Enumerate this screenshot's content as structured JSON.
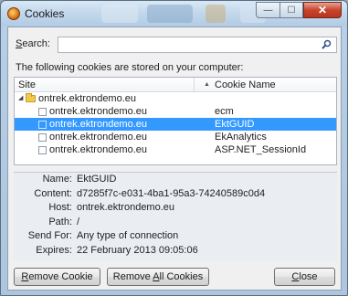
{
  "window": {
    "title": "Cookies",
    "buttons": {
      "minimize": "—",
      "maximize": "☐",
      "close": "✕"
    }
  },
  "search": {
    "label_accesskey": "S",
    "label_rest": "earch:",
    "value": "",
    "placeholder": "",
    "icon": "search-icon"
  },
  "info_text": "The following cookies are stored on your computer:",
  "tree": {
    "columns": {
      "site": "Site",
      "cookie_name": "Cookie Name"
    },
    "domain": "ontrek.ektrondemo.eu",
    "rows": [
      {
        "site": "ontrek.ektrondemo.eu",
        "cookie": "ecm",
        "selected": false
      },
      {
        "site": "ontrek.ektrondemo.eu",
        "cookie": "EktGUID",
        "selected": true
      },
      {
        "site": "ontrek.ektrondemo.eu",
        "cookie": "EkAnalytics",
        "selected": false
      },
      {
        "site": "ontrek.ektrondemo.eu",
        "cookie": "ASP.NET_SessionId",
        "selected": false
      }
    ]
  },
  "details": [
    {
      "label": "Name:",
      "value": "EktGUID"
    },
    {
      "label": "Content:",
      "value": "d7285f7c-e031-4ba1-95a3-74240589c0d4"
    },
    {
      "label": "Host:",
      "value": "ontrek.ektrondemo.eu"
    },
    {
      "label": "Path:",
      "value": "/"
    },
    {
      "label": "Send For:",
      "value": "Any type of connection"
    },
    {
      "label": "Expires:",
      "value": "22 February 2013 09:05:06"
    }
  ],
  "actions": {
    "remove_key": "R",
    "remove_rest": "emove Cookie",
    "remove_all_pre": "Remove ",
    "remove_all_key": "A",
    "remove_all_rest": "ll Cookies",
    "close_key": "C",
    "close_rest": "lose"
  }
}
